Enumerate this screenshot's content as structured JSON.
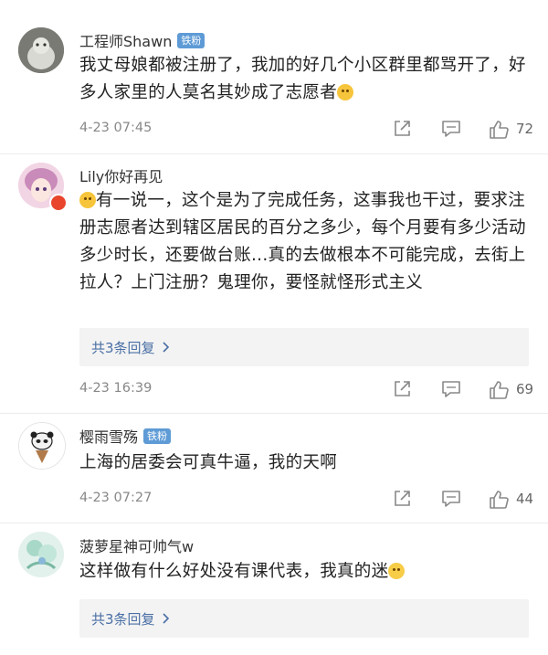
{
  "comments": [
    {
      "name": "工程师Shawn",
      "badge": "铁粉",
      "content": "我丈母娘都被注册了，我加的好几个小区群里都骂开了，好多人家里的人莫名其妙成了志愿者",
      "content_emoji": "laughing-crying-emoji",
      "time": "4-23 07:45",
      "likes": "72"
    },
    {
      "name": "Lily你好再见",
      "content_emoji": "laughing-crying-emoji",
      "content": "有一说一，这个是为了完成任务，这事我也干过，要求注册志愿者达到辖区居民的百分之多少，每个月要有多少活动多少时长，还要做台账...真的去做根本不可能完成，去街上拉人？上门注册？鬼理你，要怪就怪形式主义",
      "replies": "共3条回复",
      "time": "4-23 16:39",
      "likes": "69"
    },
    {
      "name": "樱雨雪殇",
      "badge": "铁粉",
      "content": "上海的居委会可真牛逼，我的天啊",
      "time": "4-23 07:27",
      "likes": "44"
    },
    {
      "name": "菠萝星神可帅气w",
      "content": "这样做有什么好处没有课代表，我真的迷",
      "content_emoji": "crying-emoji",
      "replies": "共3条回复"
    }
  ],
  "icons": {
    "share": "share-icon",
    "comment": "comment-icon",
    "like": "thumbs-up-icon",
    "chevron": "chevron-right-icon"
  },
  "colors": {
    "badge": "#5e9bd6",
    "link": "#4a6fa5",
    "meta": "#888888"
  }
}
